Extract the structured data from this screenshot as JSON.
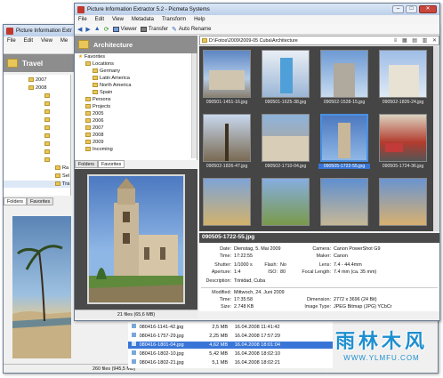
{
  "back_window": {
    "title": "Picture Information Extr",
    "menu": [
      "File",
      "Edit",
      "View",
      "Me"
    ],
    "folder_title": "Travel",
    "tree": [
      "2007",
      "2008",
      "Ra",
      "Sel",
      "Tra"
    ],
    "tabs": [
      "Folders",
      "Favorites"
    ],
    "status": "260 files (945,5 MB)",
    "colors": {
      "titlebar": "#c8d8ec"
    }
  },
  "front_window": {
    "title": "Picture Information Extractor 5.2 - Picmeta Systems",
    "menu": [
      "File",
      "Edit",
      "View",
      "Metadata",
      "Transform",
      "Help"
    ],
    "toolbar": {
      "viewer": "Viewer",
      "transfer": "Transfer",
      "auto_rename": "Auto Rename"
    },
    "folder_title": "Architecture",
    "path": "D:\\Fotos\\2009\\2009-05 Cuba\\Architecture",
    "favorites_label": "Favorites",
    "tree": [
      {
        "label": "Locations",
        "level": 1
      },
      {
        "label": "Germany",
        "level": 2
      },
      {
        "label": "Latin America",
        "level": 2
      },
      {
        "label": "North America",
        "level": 2
      },
      {
        "label": "Spain",
        "level": 2
      },
      {
        "label": "Persons",
        "level": 1
      },
      {
        "label": "Projects",
        "level": 1
      },
      {
        "label": "2005",
        "level": 1
      },
      {
        "label": "2006",
        "level": 1
      },
      {
        "label": "2007",
        "level": 1
      },
      {
        "label": "2008",
        "level": 1
      },
      {
        "label": "2009",
        "level": 1
      },
      {
        "label": "Incoming",
        "level": 1
      }
    ],
    "tabs": [
      "Folders",
      "Favorites"
    ],
    "preview_status": "21 files (65,6 MB)",
    "thumbnails": [
      "090501-1451-16.jpg",
      "090501-1625-38.jpg",
      "090502-1528-15.jpg",
      "090502-1826-24.jpg",
      "090502-1826-47.jpg",
      "090502-1710-04.jpg",
      "090505-1722-55.jpg",
      "090505-1724-36.jpg",
      "",
      "",
      "",
      ""
    ],
    "selected_file": "090505-1722-55.jpg",
    "info": {
      "date_label": "Date:",
      "date": "Dienstag, 5. Mai 2009",
      "time_label": "Time:",
      "time": "17:22:55",
      "shutter_label": "Shutter:",
      "shutter": "1/1000 s",
      "flash_label": "Flash:",
      "flash": "No",
      "aperture_label": "Aperture:",
      "aperture": "1:4",
      "iso_label": "ISO:",
      "iso": "80",
      "desc_label": "Description:",
      "desc": "Trinidad, Cuba",
      "camera_label": "Camera:",
      "camera": "Canon PowerShot G9",
      "maker_label": "Maker:",
      "maker": "Canon",
      "lens_label": "Lens:",
      "lens": "7.4 - 44.4mm",
      "focal_label": "Focal Length:",
      "focal": "7.4 mm (ca. 35 mm)",
      "modified_label": "Modified:",
      "modified": "Mittwoch, 24. Juni 2009",
      "mtime_label": "Time:",
      "mtime": "17:35:58",
      "size_label": "Size:",
      "size": "2.748 KB",
      "dim_label": "Dimension:",
      "dim": "2772 x 3696 (24 Bit)",
      "type_label": "Image Type:",
      "type": "JPEG Bitmap (JPG) YCbCr"
    }
  },
  "file_list": [
    {
      "name": "080416-1141-42.jpg",
      "size": "2,5 MB",
      "date": "16.04.2008 11:41:42"
    },
    {
      "name": "080416-1757-29.jpg",
      "size": "2,25 MB",
      "date": "16.04.2008 17:57:29"
    },
    {
      "name": "080416-1801-04.jpg",
      "size": "4,62 MB",
      "date": "16.04.2008 18:01:04",
      "selected": true
    },
    {
      "name": "080416-1802-10.jpg",
      "size": "5,42 MB",
      "date": "16.04.2008 18:02:10"
    },
    {
      "name": "080416-1802-21.jpg",
      "size": "5,1 MB",
      "date": "16.04.2008 18:02:21"
    }
  ],
  "watermark": {
    "brand": "雨林木风",
    "url": "WWW.YLMFU.COM"
  },
  "colors": {
    "accent": "#3875d7",
    "folder_header": "#8a8a8a",
    "dark_bg": "#4a4a4a"
  }
}
